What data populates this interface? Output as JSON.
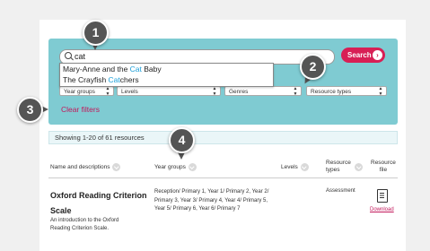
{
  "search": {
    "value": "cat",
    "button_label": "Search",
    "suggestions": [
      {
        "pre": "Mary-Anne and the ",
        "hl": "Cat",
        "post": " Baby"
      },
      {
        "pre": "The Crayfish ",
        "hl": "Cat",
        "post": "chers"
      }
    ]
  },
  "filters": {
    "year_groups": "Year groups",
    "levels": "Levels",
    "genres": "Genres",
    "resource_types": "Resource types",
    "clear": "Clear filters"
  },
  "badges": [
    "1",
    "2",
    "3",
    "4"
  ],
  "results": {
    "showing": "Showing 1-20 of 61 resources",
    "headers": {
      "name": "Name and descriptions",
      "year_groups": "Year groups",
      "levels": "Levels",
      "resource_types_1": "Resource",
      "resource_types_2": "types",
      "resource_file_1": "Resource",
      "resource_file_2": "file"
    },
    "rows": [
      {
        "title": "Oxford Reading Criterion Scale",
        "description": "An introduction to the Oxford Reading Criterion Scale.",
        "years": "Reception/ Primary 1, Year 1/ Primary 2, Year 2/ Primary 3, Year 3/ Primary 4, Year 4/ Primary 5, Year 5/ Primary 6, Year 6/ Primary 7",
        "type": "Assessment",
        "download": "Download"
      }
    ]
  }
}
